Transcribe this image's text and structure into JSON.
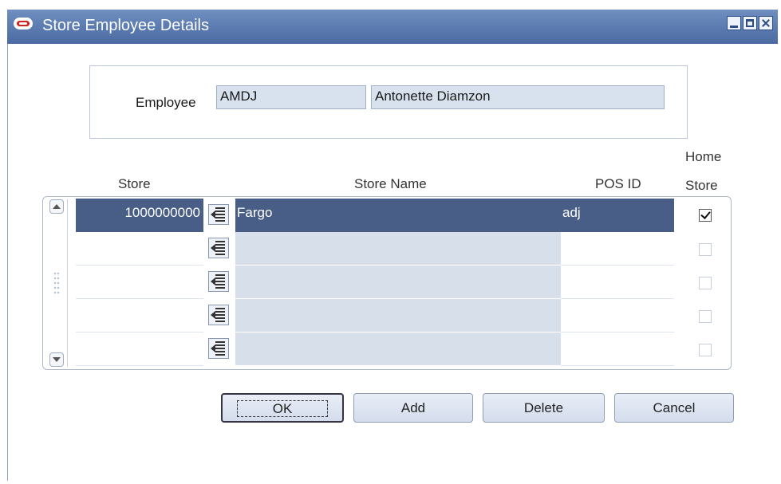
{
  "window": {
    "title": "Store Employee Details"
  },
  "employee": {
    "label": "Employee",
    "id": "AMDJ",
    "name": "Antonette Diamzon"
  },
  "table": {
    "headers": {
      "store": "Store",
      "store_name": "Store Name",
      "pos_id": "POS ID",
      "home_store_line1": "Home",
      "home_store_line2": "Store"
    },
    "rows": [
      {
        "store": "1000000000",
        "store_name": "Fargo",
        "pos_id": "adj",
        "home_store": true
      },
      {
        "store": "",
        "store_name": "",
        "pos_id": "",
        "home_store": false
      },
      {
        "store": "",
        "store_name": "",
        "pos_id": "",
        "home_store": false
      },
      {
        "store": "",
        "store_name": "",
        "pos_id": "",
        "home_store": false
      },
      {
        "store": "",
        "store_name": "",
        "pos_id": "",
        "home_store": false
      }
    ]
  },
  "buttons": {
    "ok": "OK",
    "add": "Add",
    "delete": "Delete",
    "cancel": "Cancel"
  },
  "colors": {
    "title_bar": "#4a6aa2",
    "selected_row": "#485e86",
    "readonly_field": "#d8e2ee"
  }
}
